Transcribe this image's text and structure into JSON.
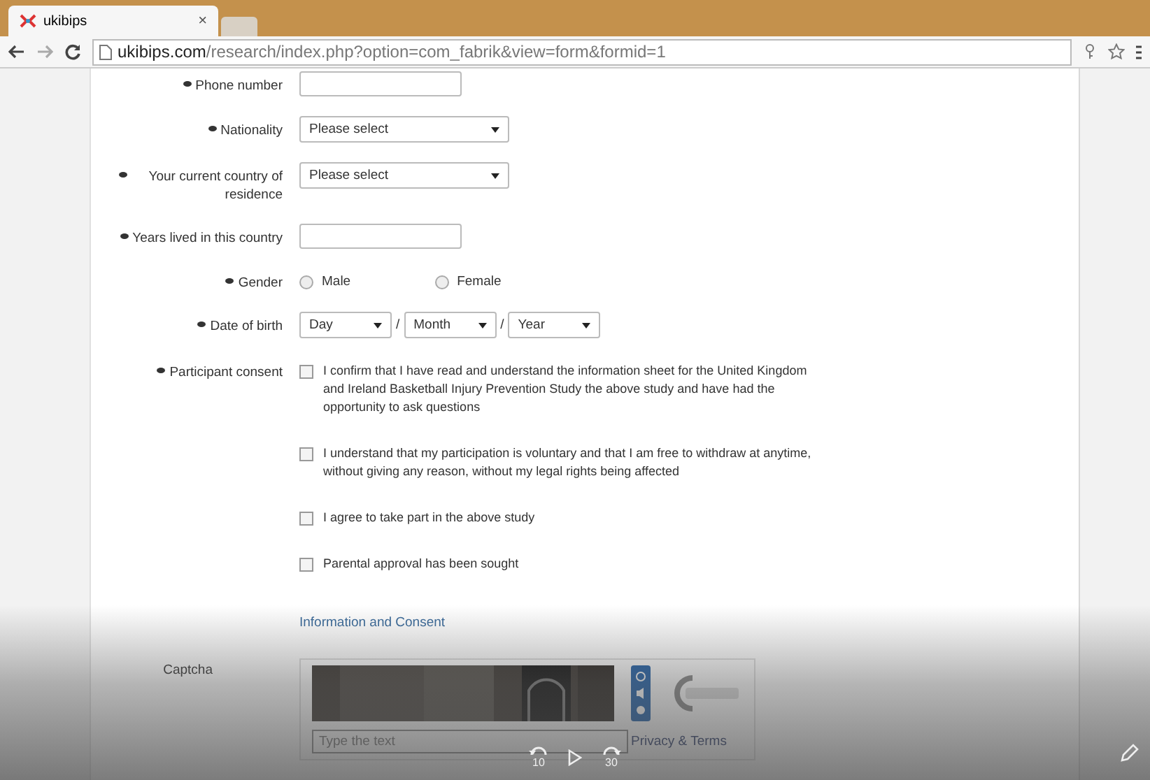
{
  "browser": {
    "tab": {
      "title": "ukibips",
      "close": "×"
    },
    "address": {
      "domain": "ukibips.com",
      "path": "/research/index.php?option=com_fabrik&view=form&formid=1"
    }
  },
  "form": {
    "fields": [
      {
        "kind": "text",
        "label": "Phone number",
        "required": true
      },
      {
        "kind": "select",
        "label": "Nationality",
        "required": true,
        "value": "Please select"
      },
      {
        "kind": "select",
        "label": "Your current country of residence",
        "required": true,
        "value": "Please select"
      },
      {
        "kind": "text",
        "label": "Years lived in this country",
        "required": true
      },
      {
        "kind": "radio",
        "label": "Gender",
        "required": true,
        "options": [
          {
            "label": "Male",
            "selected": false
          },
          {
            "label": "Female",
            "selected": false
          }
        ]
      },
      {
        "kind": "date",
        "label": "Date of birth",
        "required": true,
        "parts": [
          "Day",
          "Month",
          "Year"
        ],
        "separators": [
          "/",
          "/"
        ]
      },
      {
        "kind": "checks",
        "label": "Participant consent",
        "required": true,
        "options": [
          {
            "label": "I confirm that I have read and understand the information sheet for the United Kingdom and Ireland Basketball Injury Prevention Study the above study and have had the opportunity to ask questions",
            "checked": false
          },
          {
            "label": "I understand that my participation is voluntary and that I am free to withdraw at anytime, without giving any reason, without my legal rights being affected",
            "checked": false
          },
          {
            "label": "I agree to take part in the above study",
            "checked": false
          },
          {
            "label": "Parental approval has been sought",
            "checked": false
          }
        ]
      }
    ],
    "link": "Information and Consent",
    "captcha": {
      "label": "Captcha",
      "placeholder": "Type the text",
      "link": "Privacy & Terms"
    }
  },
  "player": {
    "rewind": "10",
    "forward": "30"
  }
}
